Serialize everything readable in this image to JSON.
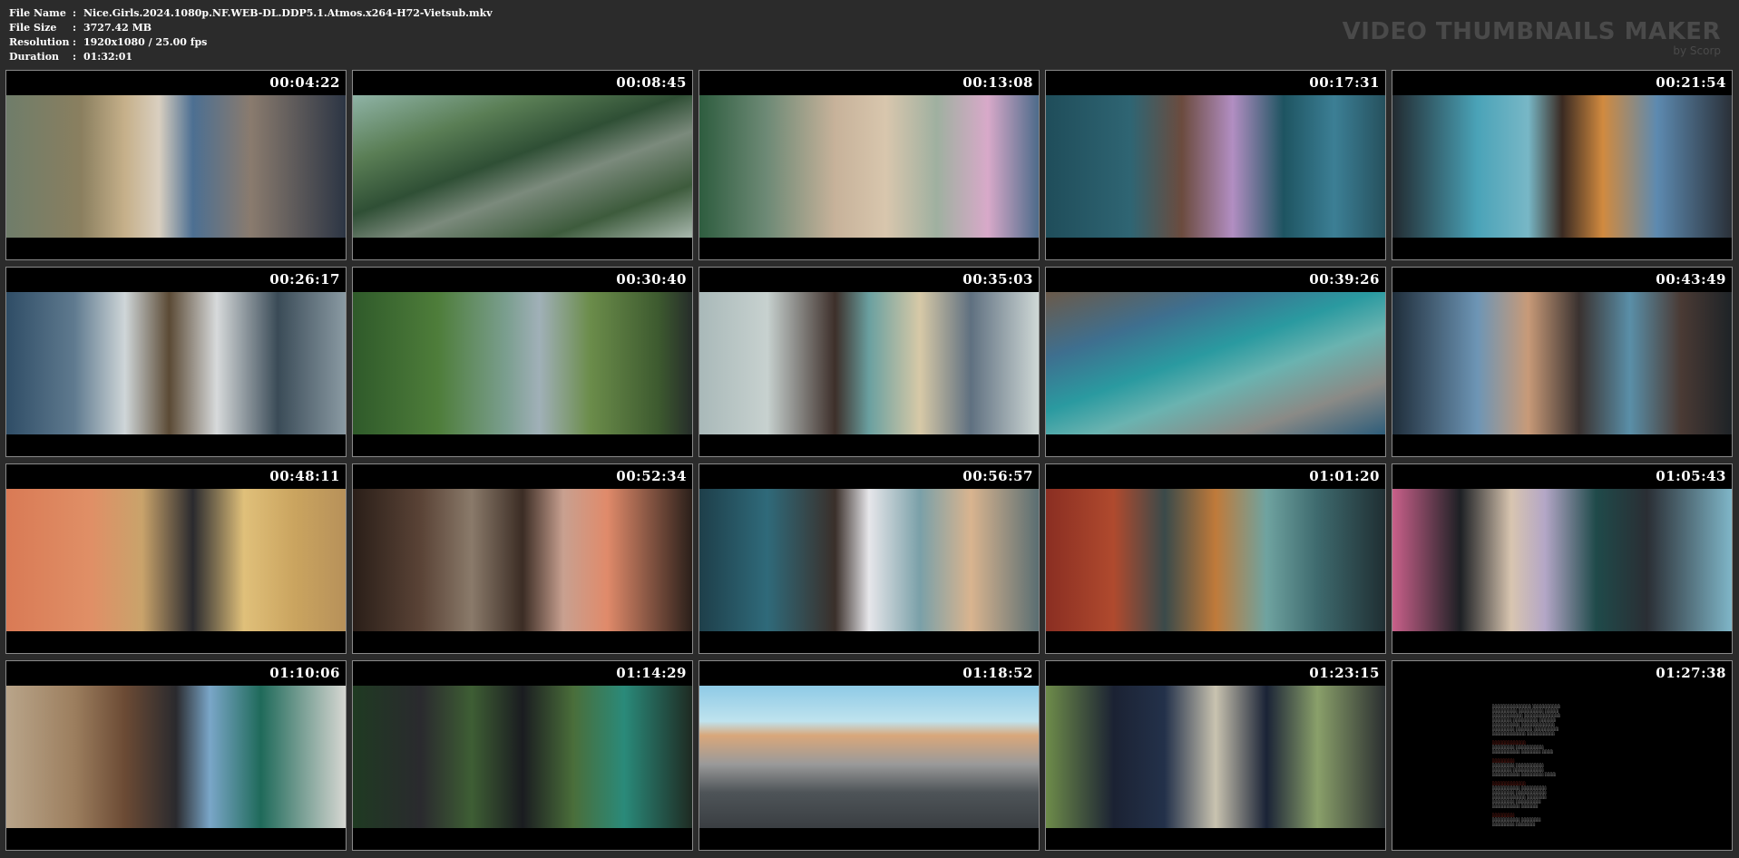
{
  "header": {
    "rows": [
      {
        "label": "File Name",
        "value": "Nice.Girls.2024.1080p.NF.WEB-DL.DDP5.1.Atmos.x264-H72-Vietsub.mkv"
      },
      {
        "label": "File Size",
        "value": "3727.42 MB"
      },
      {
        "label": "Resolution",
        "value": "1920x1080 / 25.00 fps"
      },
      {
        "label": "Duration",
        "value": "01:32:01"
      }
    ],
    "separator": ":"
  },
  "brand": {
    "title": "VIDEO THUMBNAILS MAKER",
    "subtitle": "by Scorp"
  },
  "thumbnails": [
    {
      "time": "00:04:22"
    },
    {
      "time": "00:08:45"
    },
    {
      "time": "00:13:08"
    },
    {
      "time": "00:17:31"
    },
    {
      "time": "00:21:54"
    },
    {
      "time": "00:26:17"
    },
    {
      "time": "00:30:40"
    },
    {
      "time": "00:35:03"
    },
    {
      "time": "00:39:26"
    },
    {
      "time": "00:43:49"
    },
    {
      "time": "00:48:11"
    },
    {
      "time": "00:52:34"
    },
    {
      "time": "00:56:57"
    },
    {
      "time": "01:01:20"
    },
    {
      "time": "01:05:43"
    },
    {
      "time": "01:10:06"
    },
    {
      "time": "01:14:29"
    },
    {
      "time": "01:18:52"
    },
    {
      "time": "01:23:15"
    },
    {
      "time": "01:27:38"
    }
  ]
}
